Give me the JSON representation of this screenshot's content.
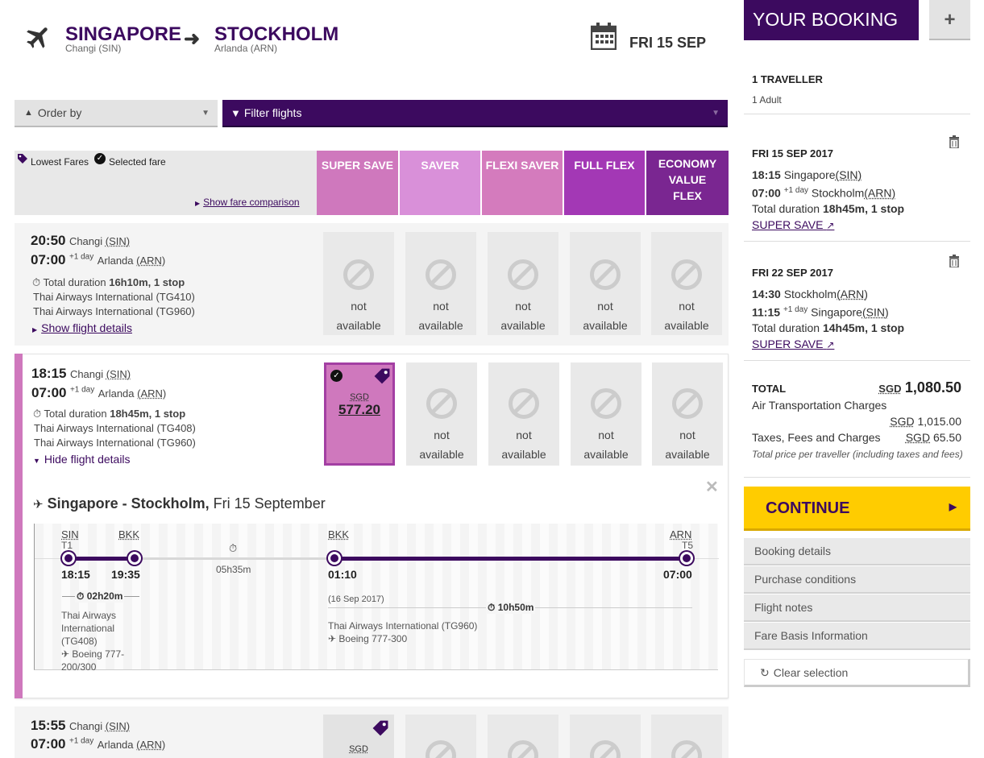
{
  "header": {
    "origin_city": "SINGAPORE",
    "origin_airport": "Changi (SIN)",
    "dest_city": "STOCKHOLM",
    "dest_airport": "Arlanda (ARN)",
    "date": "FRI 15 SEP"
  },
  "controls": {
    "order_label": "Order by",
    "filter_label": "Filter flights"
  },
  "legend": {
    "lowest_fares": "Lowest Fares",
    "selected_fare": "Selected fare",
    "compare_link": "Show fare comparison"
  },
  "fare_columns": [
    {
      "label": "SUPER SAVE",
      "color": "#cf78bd"
    },
    {
      "label": "SAVER",
      "color": "#d990d9"
    },
    {
      "label": "FLEXI SAVER",
      "color": "#d47bbd"
    },
    {
      "label": "FULL FLEX",
      "color": "#a338b5"
    },
    {
      "label": "ECONOMY VALUE FLEX",
      "color": "#7a2691"
    }
  ],
  "flights": [
    {
      "dep_time": "20:50",
      "dep_airport": "Changi",
      "dep_code": "(SIN)",
      "arr_time": "07:00",
      "plus_day": "+1 day",
      "arr_airport": "Arlanda",
      "arr_code": "(ARN)",
      "duration_prefix": "Total duration",
      "duration": "16h10m, 1 stop",
      "carrier1": "Thai Airways International (TG410)",
      "carrier2": "Thai Airways International (TG960)",
      "details_link": "Show flight details"
    },
    {
      "dep_time": "18:15",
      "dep_airport": "Changi",
      "dep_code": "(SIN)",
      "arr_time": "07:00",
      "plus_day": "+1 day",
      "arr_airport": "Arlanda",
      "arr_code": "(ARN)",
      "duration_prefix": "Total duration",
      "duration": "18h45m, 1 stop",
      "carrier1": "Thai Airways International (TG408)",
      "carrier2": "Thai Airways International (TG960)",
      "details_link": "Hide flight details",
      "price_currency": "SGD",
      "price": "577.20"
    },
    {
      "dep_time": "15:55",
      "dep_airport": "Changi",
      "dep_code": "(SIN)",
      "arr_time": "07:00",
      "plus_day": "+1 day",
      "arr_airport": "Arlanda",
      "arr_code": "(ARN)",
      "price_currency": "SGD"
    }
  ],
  "not_available": [
    "not",
    "available"
  ],
  "detail": {
    "route": "Singapore - Stockholm,",
    "date": "Fri 15 September",
    "seg1": {
      "from": "SIN",
      "from_term": "T1",
      "to": "BKK",
      "dep": "18:15",
      "arr": "19:35",
      "duration": "02h20m",
      "carrier": "Thai Airways International (TG408)",
      "aircraft": "Boeing 777-200/300"
    },
    "layover": "05h35m",
    "seg2": {
      "from": "BKK",
      "to": "ARN",
      "to_term": "T5",
      "dep": "01:10",
      "arr": "07:00",
      "date_note": "(16 Sep 2017)",
      "duration": "10h50m",
      "carrier": "Thai Airways International (TG960)",
      "aircraft": "Boeing 777-300"
    }
  },
  "booking": {
    "title": "YOUR BOOKING",
    "add_label": "+",
    "travellers": "1 TRAVELLER",
    "adults": "1 Adult",
    "outbound": {
      "date": "FRI 15 SEP 2017",
      "dep_time": "18:15",
      "dep_city": "Singapore",
      "dep_code": "(SIN)",
      "arr_time": "07:00",
      "plus_day": "+1 day",
      "arr_city": "Stockholm",
      "arr_code": "(ARN)",
      "duration_prefix": "Total duration",
      "duration": "18h45m, 1 stop",
      "fare": "SUPER SAVE"
    },
    "inbound": {
      "date": "FRI 22 SEP 2017",
      "dep_time": "14:30",
      "dep_city": "Stockholm",
      "dep_code": "(ARN)",
      "arr_time": "11:15",
      "plus_day": "+1 day",
      "arr_city": "Singapore",
      "arr_code": "(SIN)",
      "duration_prefix": "Total duration",
      "duration": "14h45m, 1 stop",
      "fare": "SUPER SAVE"
    },
    "total_label": "TOTAL",
    "total_currency": "SGD",
    "total_amount": "1,080.50",
    "air_label": "Air Transportation Charges",
    "air_currency": "SGD",
    "air_amount": "1,015.00",
    "tax_label": "Taxes, Fees and Charges",
    "tax_currency": "SGD",
    "tax_amount": "65.50",
    "note": "Total price per traveller (including taxes and fees)",
    "continue_label": "CONTINUE",
    "menu": [
      "Booking details",
      "Purchase conditions",
      "Flight notes",
      "Fare Basis Information"
    ],
    "clear_label": "Clear selection"
  },
  "colors": {
    "brand": "#3c0a5f",
    "accent": "#ffcc00",
    "selected": "#cf78bd"
  }
}
